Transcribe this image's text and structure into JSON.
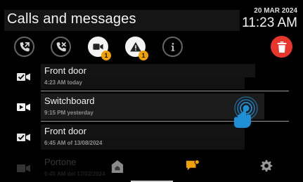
{
  "header": {
    "title": "Calls and messages",
    "date": "20 MAR 2024",
    "time": "11:23 AM"
  },
  "tabs": [
    {
      "name": "outgoing-calls",
      "icon": "phone-outgoing-icon",
      "active": false
    },
    {
      "name": "missed-calls",
      "icon": "phone-missed-icon",
      "active": false
    },
    {
      "name": "video-messages",
      "icon": "video-camera-icon",
      "active": true,
      "badge": "1"
    },
    {
      "name": "alarms",
      "icon": "warning-icon",
      "active": false,
      "badge": "1"
    },
    {
      "name": "info",
      "icon": "info-icon",
      "active": false
    }
  ],
  "delete": {
    "icon": "trash-icon",
    "color": "#e8362c"
  },
  "list": [
    {
      "name": "Front door",
      "subtitle": "4:23 AM today",
      "icon": "video-message-read-icon"
    },
    {
      "name": "Switchboard",
      "subtitle": "9:15 PM yesterday",
      "icon": "video-message-unread-icon",
      "selected": true
    },
    {
      "name": "Front door",
      "subtitle": "6:45 AM of 13/08/2024",
      "icon": "video-message-read-icon"
    },
    {
      "name": "Portone",
      "subtitle": "6:45 AM del 17/02/2024",
      "icon": "video-message-read-icon",
      "faded": true
    }
  ],
  "bottomnav": [
    {
      "name": "home",
      "icon": "home-icon"
    },
    {
      "name": "messages",
      "icon": "chat-bubble-icon",
      "active": true
    },
    {
      "name": "settings",
      "icon": "gear-icon"
    }
  ],
  "colors": {
    "accent_orange": "#f0a000",
    "delete_red": "#e8362c",
    "touch_blue": "#1f8fd6"
  }
}
